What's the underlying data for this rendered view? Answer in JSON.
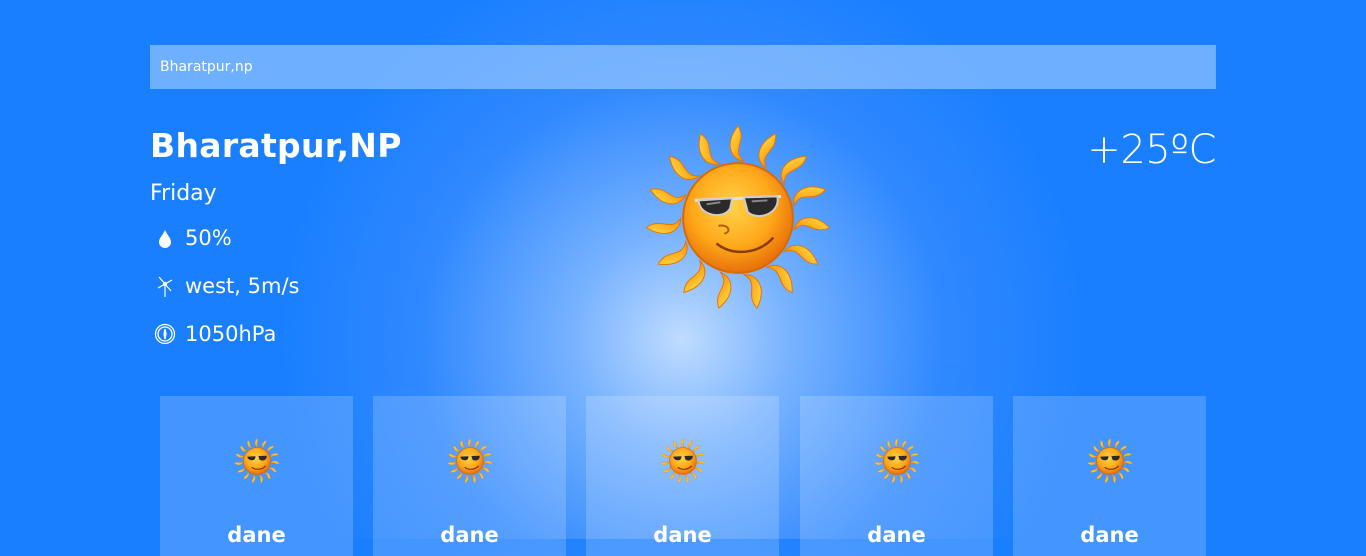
{
  "search": {
    "value": "Bharatpur,np"
  },
  "location": {
    "name": "Bharatpur,NP",
    "day": "Friday"
  },
  "stats": {
    "humidity": "50%",
    "wind": "west, 5m/s",
    "pressure": "1050hPa"
  },
  "temperature": "+25ºC",
  "weather_icon": "sun-with-sunglasses-icon",
  "forecast": [
    {
      "label": "dane",
      "icon": "sun-with-sunglasses-icon"
    },
    {
      "label": "dane",
      "icon": "sun-with-sunglasses-icon"
    },
    {
      "label": "dane",
      "icon": "sun-with-sunglasses-icon"
    },
    {
      "label": "dane",
      "icon": "sun-with-sunglasses-icon"
    },
    {
      "label": "dane",
      "icon": "sun-with-sunglasses-icon"
    }
  ],
  "colors": {
    "background": "#1a7fff",
    "text": "#ffffff"
  }
}
